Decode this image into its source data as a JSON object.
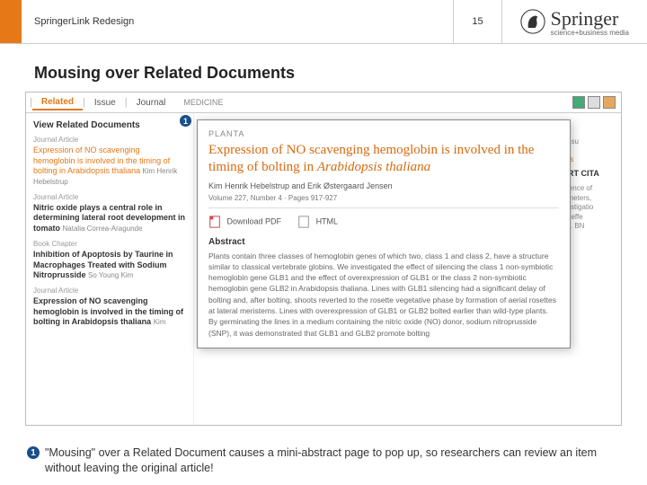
{
  "header": {
    "title": "SpringerLink Redesign",
    "page_number": "15",
    "brand": "Springer",
    "tagline": "science+business media"
  },
  "section_title": "Mousing over Related Documents",
  "tabs": {
    "related": "Related",
    "issue": "Issue",
    "journal": "Journal",
    "breadcrumb": "MEDICINE"
  },
  "sidebar": {
    "heading": "View Related Documents",
    "marker": "1",
    "items": [
      {
        "type": "Journal Article",
        "title_parts": [
          "Expression of NO scavenging",
          "hemoglobin is involved in the timing of",
          "bolting in Arabidopsis thaliana"
        ],
        "author_suffix": " Kim Henrik Hebelstrup"
      },
      {
        "type": "Journal Article",
        "title": "Nitric oxide plays a central role in determining lateral root development in tomato",
        "author": "Natalia Correa-Aragunde"
      },
      {
        "type": "Book Chapter",
        "title": "Inhibition of Apoptosis by Taurine in Macrophages Treated with Sodium Nitroprusside",
        "author": "So Young Kim"
      },
      {
        "type": "Journal Article",
        "title": "Expression of NO scavenging hemoglobin is involved in the timing of bolting in Arabidopsis thaliana",
        "author": "Kim"
      }
    ]
  },
  "popup": {
    "journal": "PLANTA",
    "title_plain": "Expression of NO scavenging hemoglobin is involved in the timing of bolting in ",
    "title_em": "Arabidopsis thaliana",
    "authors": "Kim Henrik Hebelstrup and Erik Østergaard Jensen",
    "volume": "Volume 227, Number 4 · Pages 917-927",
    "download_pdf": "Download PDF",
    "html": "HTML",
    "section": "Abstract",
    "abstract": "Plants contain three classes of hemoglobin genes of which two, class 1 and class 2, have a structure similar to classical vertebrate globins. We investigated the effect of silencing the class 1 non-symbiotic hemoglobin gene GLB1 and the effect of overexpression of GLB1 or the class 2 non-symbiotic hemoglobin gene GLB2 in Arabidopsis thaliana. Lines with GLB1 silencing had a significant delay of bolting and, after bolting, shoots reverted to the rosette vegetative phase by formation of aerial rosettes at lateral meristems. Lines with overexpression of GLB1 or GLB2 bolted earlier than wild-type plants. By germinating the lines in a medium containing the nitric oxide (NO) donor, sodium nitroprusside (SNP), it was demonstrated that GLB1 and GLB2 promote bolting "
  },
  "bg_text": {
    "frag1": "gen consu",
    "perm": "Permis",
    "export": "EXPORT CITA",
    "frag2": "ne influence of",
    "frag3": "al parameters,",
    "frag4": "ete investigatio",
    "frag5": "udy the effe",
    "frag6": "dl effect. BN"
  },
  "footer": {
    "marker": "1",
    "text": "\"Mousing\" over a Related Document causes a mini-abstract page to pop up, so researchers can review an item without leaving the original article!"
  }
}
